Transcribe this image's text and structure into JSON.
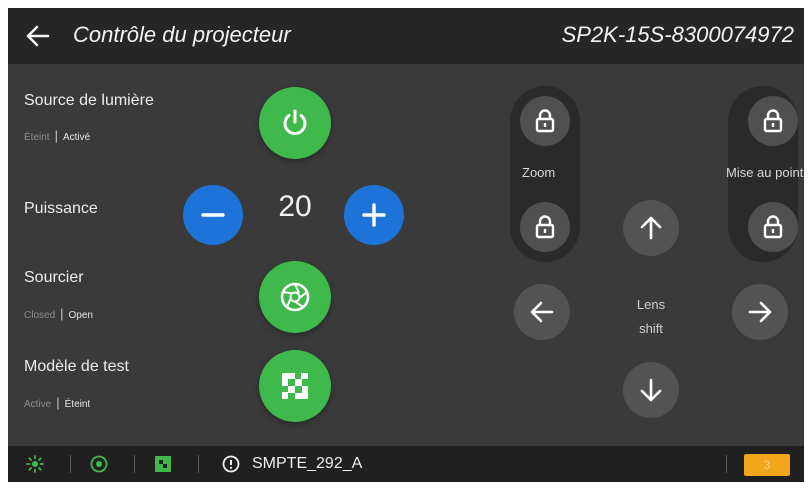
{
  "header": {
    "title": "Contrôle du projecteur",
    "serial": "SP2K-15S-8300074972"
  },
  "controls": {
    "light_source": {
      "label": "Source de lumière",
      "state_off": "Éteint",
      "state_on": "Activé"
    },
    "power": {
      "label": "Puissance",
      "value": "20"
    },
    "shutter": {
      "label": "Sourcier",
      "state_off": "Closed",
      "state_on": "Open"
    },
    "test_pattern": {
      "label": "Modèle de test",
      "state_off": "Active",
      "state_on": "Éteint"
    }
  },
  "lens": {
    "zoom_label": "Zoom",
    "focus_label": "Mise au point",
    "shift_label_1": "Lens",
    "shift_label_2": "shift"
  },
  "footer": {
    "pattern_name": "SMPTE_292_A",
    "badge": "3"
  },
  "colors": {
    "green": "#3fb84c",
    "blue": "#1e73d8",
    "badge": "#f2a41a"
  }
}
